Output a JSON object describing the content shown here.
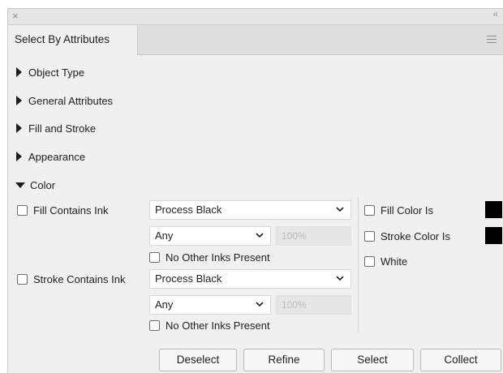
{
  "window": {
    "close_glyph": "×",
    "collapse_glyph": "‹‹"
  },
  "tab": {
    "label": "Select By Attributes"
  },
  "sections": [
    {
      "label": "Object Type",
      "state": "collapsed"
    },
    {
      "label": "General Attributes",
      "state": "collapsed"
    },
    {
      "label": "Fill and Stroke",
      "state": "collapsed"
    },
    {
      "label": "Appearance",
      "state": "collapsed"
    },
    {
      "label": "Color",
      "state": "expanded"
    }
  ],
  "color": {
    "fill_contains_ink": {
      "label": "Fill Contains Ink",
      "checked": false,
      "ink_select": "Process Black",
      "tint_select": "Any",
      "tint_percent": "100%",
      "no_other_inks_label": "No Other Inks Present"
    },
    "stroke_contains_ink": {
      "label": "Stroke Contains Ink",
      "checked": false,
      "ink_select": "Process Black",
      "tint_select": "Any",
      "tint_percent": "100%",
      "no_other_inks_label": "No Other Inks Present"
    },
    "fill_color_is": {
      "label": "Fill Color Is",
      "checked": false,
      "swatch_color": "#000000"
    },
    "stroke_color_is": {
      "label": "Stroke Color Is",
      "checked": false,
      "swatch_color": "#000000"
    },
    "white": {
      "label": "White",
      "checked": false
    }
  },
  "buttons": {
    "deselect": "Deselect",
    "refine": "Refine",
    "select": "Select",
    "collect": "Collect"
  },
  "icons": {
    "close": "close-icon",
    "collapse": "double-chevron-left-icon",
    "menu": "hamburger-menu-icon",
    "section_collapsed": "triangle-right-icon",
    "section_expanded": "triangle-down-icon",
    "dropdown": "chevron-down-icon"
  }
}
